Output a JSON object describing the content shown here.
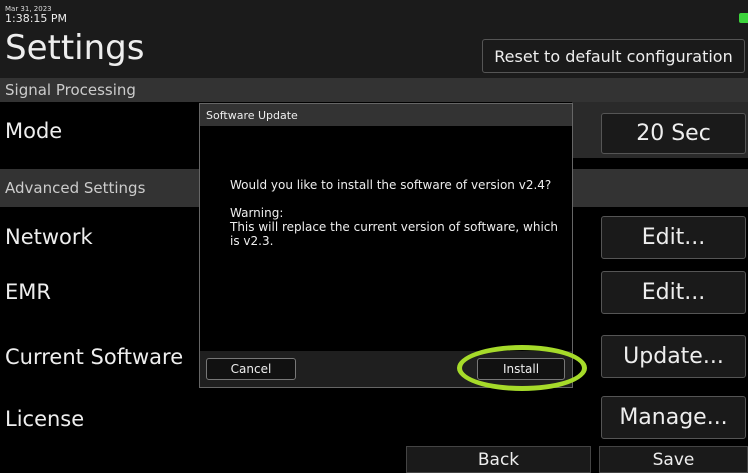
{
  "header": {
    "date": "Mar 31, 2023",
    "time": "1:38:15 PM",
    "title": "Settings",
    "reset_label": "Reset to default configuration"
  },
  "sections": {
    "signal_processing": "Signal Processing",
    "advanced_settings": "Advanced Settings"
  },
  "rows": {
    "mode": {
      "label": "Mode",
      "value": "20 Sec"
    },
    "network": {
      "label": "Network",
      "button": "Edit..."
    },
    "emr": {
      "label": "EMR",
      "button": "Edit..."
    },
    "current_software": {
      "label": "Current Software",
      "button": "Update..."
    },
    "license": {
      "label": "License",
      "button": "Manage..."
    }
  },
  "dialog": {
    "title": "Software Update",
    "question": "Would you like to install the software of version v2.4?",
    "warning_heading": "Warning:",
    "warning_text": "This will replace the current version of software, which is v2.3.",
    "cancel_label": "Cancel",
    "install_label": "Install"
  },
  "footer": {
    "back_label": "Back",
    "save_label": "Save"
  },
  "colors": {
    "highlight": "#a6db2a",
    "battery": "#3cd43c"
  }
}
